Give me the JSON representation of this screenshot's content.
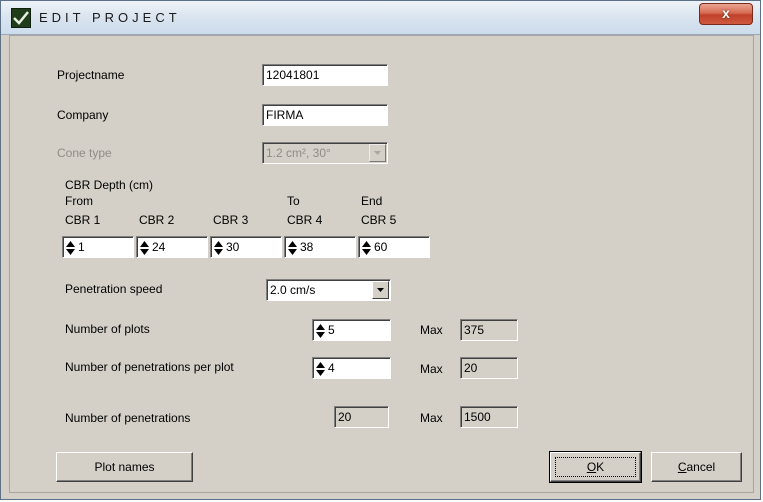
{
  "window": {
    "title": "EDIT PROJECT",
    "close_glyph": "x"
  },
  "form": {
    "projectname": {
      "label": "Projectname",
      "value": "12041801"
    },
    "company": {
      "label": "Company",
      "value": "FIRMA"
    },
    "cone_type": {
      "label": "Cone type",
      "value": "1.2  cm², 30°"
    },
    "cbr": {
      "title": "CBR Depth (cm)",
      "from_label": "From",
      "to_label": "To",
      "end_label": "End",
      "fields": [
        {
          "label": "CBR 1",
          "value": "1"
        },
        {
          "label": "CBR 2",
          "value": "24"
        },
        {
          "label": "CBR 3",
          "value": "30"
        },
        {
          "label": "CBR 4",
          "value": "38"
        },
        {
          "label": "CBR 5",
          "value": "60"
        }
      ]
    },
    "penetration_speed": {
      "label": "Penetration speed",
      "value": "2.0 cm/s"
    },
    "number_of_plots": {
      "label": "Number of plots",
      "value": "5",
      "max_label": "Max",
      "max_value": "375"
    },
    "penetrations_per_plot": {
      "label": "Number of penetrations per plot",
      "value": "4",
      "max_label": "Max",
      "max_value": "20"
    },
    "number_of_penetrations": {
      "label": "Number of penetrations",
      "value": "20",
      "max_label": "Max",
      "max_value": "1500"
    }
  },
  "buttons": {
    "plot_names": "Plot names",
    "ok_accel": "O",
    "ok_rest": "K",
    "cancel_accel": "C",
    "cancel_rest": "ancel"
  },
  "icons": {
    "app": "app-logo-icon",
    "close": "close-icon",
    "spinner": "spinner-arrows-icon",
    "dropdown": "chevron-down-icon"
  },
  "colors": {
    "dialog_bg": "#d4d0c8",
    "close_button": "#c0412a",
    "disabled_text": "#8f8b86"
  }
}
